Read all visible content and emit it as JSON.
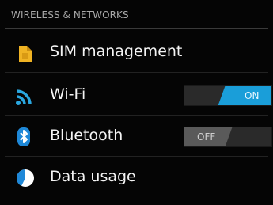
{
  "section": {
    "title": "WIRELESS & NETWORKS"
  },
  "items": [
    {
      "label": "SIM management",
      "icon": "sim-card-icon"
    },
    {
      "label": "Wi-Fi",
      "icon": "wifi-icon",
      "toggle": "ON"
    },
    {
      "label": "Bluetooth",
      "icon": "bluetooth-icon",
      "toggle": "OFF"
    },
    {
      "label": "Data usage",
      "icon": "data-usage-icon"
    }
  ],
  "colors": {
    "accent": "#1a9ed9",
    "background": "#050505",
    "header_text": "#a8a8a8"
  }
}
